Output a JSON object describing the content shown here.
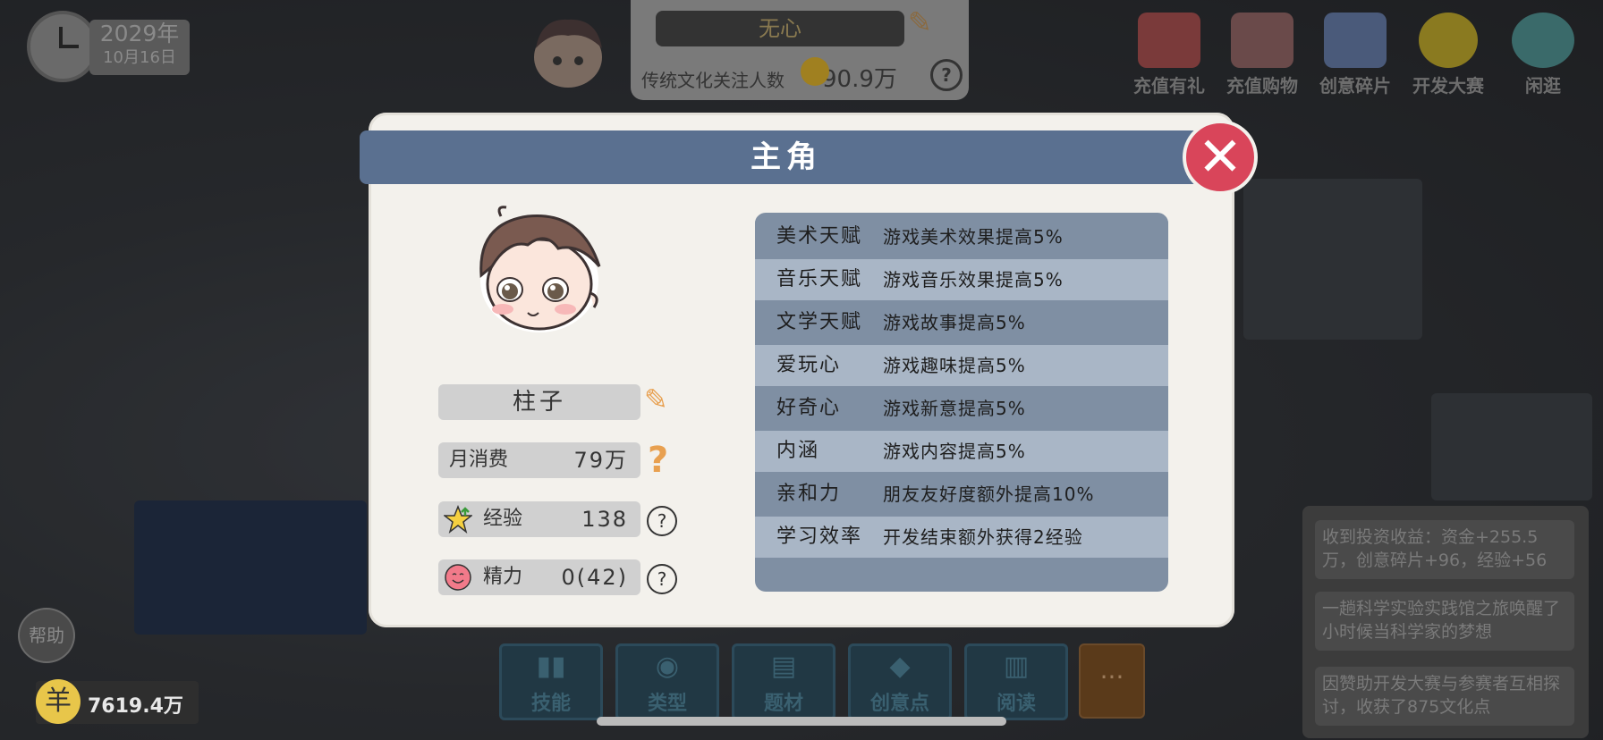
{
  "hud": {
    "date_year": "2029年",
    "date_day": "10月16日",
    "top_name": "无心",
    "follow_label": "传统文化关注人数",
    "follow_value": "90.9万",
    "help": "帮助",
    "money_icon": "羊",
    "money": "7619.4万",
    "more": "···"
  },
  "top_icons": [
    {
      "label": "充值有礼",
      "icon": "gift-icon"
    },
    {
      "label": "充值购物",
      "icon": "shop-icon"
    },
    {
      "label": "创意碎片",
      "icon": "gift-box-icon"
    },
    {
      "label": "开发大赛",
      "icon": "code-coin-icon"
    },
    {
      "label": "闲逛",
      "icon": "park-bench-icon"
    }
  ],
  "toolbar": [
    {
      "label": "技能",
      "icon": "book-icon"
    },
    {
      "label": "类型",
      "icon": "gamepad-icon"
    },
    {
      "label": "题材",
      "icon": "notebook-icon"
    },
    {
      "label": "创意点",
      "icon": "diamond-icon"
    },
    {
      "label": "阅读",
      "icon": "open-book-icon"
    }
  ],
  "messages": [
    "收到投资收益：资金+255.5万，创意碎片+96，经验+56",
    "一趟科学实验实践馆之旅唤醒了小时候当科学家的梦想",
    "因赞助开发大赛与参赛者互相探讨，收获了875文化点"
  ],
  "modal": {
    "title": "主角",
    "close": "✕",
    "name": "柱子",
    "stats": [
      {
        "key": "月消费",
        "value": "79万"
      },
      {
        "key": "经验",
        "value": "138"
      },
      {
        "key": "精力",
        "value": "0(42)"
      }
    ],
    "help_q": "?"
  },
  "traits": [
    {
      "name": "美术天赋",
      "desc": "游戏美术效果提高5%"
    },
    {
      "name": "音乐天赋",
      "desc": "游戏音乐效果提高5%"
    },
    {
      "name": "文学天赋",
      "desc": "游戏故事提高5%"
    },
    {
      "name": "爱玩心",
      "desc": "游戏趣味提高5%"
    },
    {
      "name": "好奇心",
      "desc": "游戏新意提高5%"
    },
    {
      "name": "内涵",
      "desc": "游戏内容提高5%"
    },
    {
      "name": "亲和力",
      "desc": "朋友友好度额外提高10%"
    },
    {
      "name": "学习效率",
      "desc": "开发结束额外获得2经验"
    }
  ],
  "colors": {
    "title_bar": "#5a7090",
    "close_button": "#d9455a",
    "trait_dark": "#7f8fa3",
    "trait_light": "#a9b6c6",
    "accent_orange": "#e8a050"
  }
}
